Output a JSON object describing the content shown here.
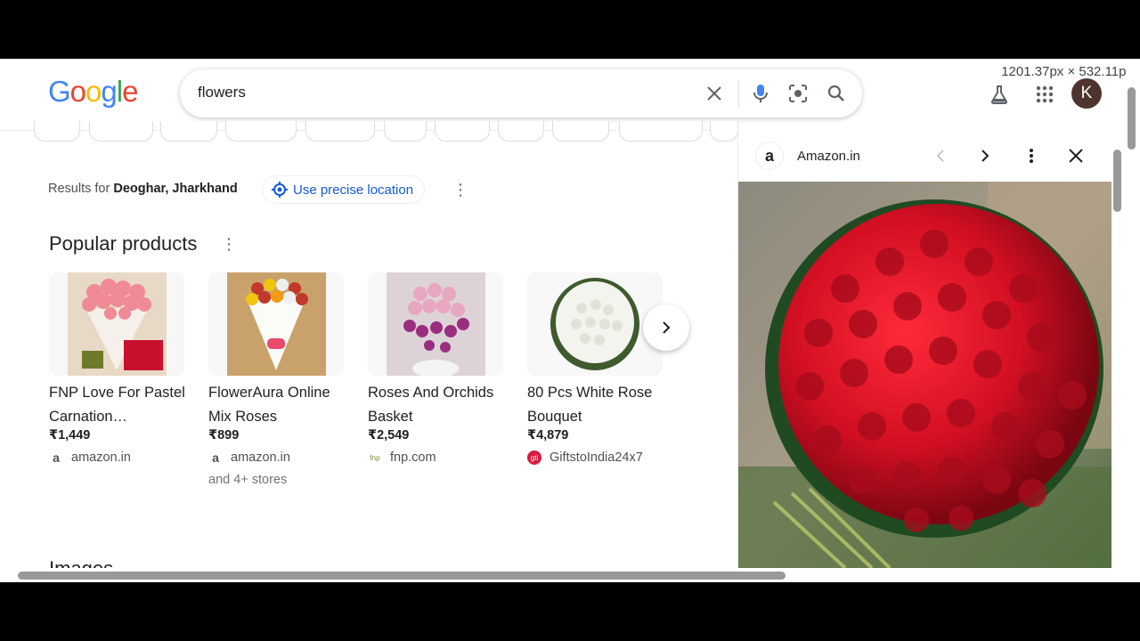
{
  "header": {
    "logo_text": "Google",
    "search_query": "flowers",
    "dimension_readout": "1201.37px × 532.11px",
    "avatar_initial": "K",
    "icons": [
      "clear-icon",
      "mic-icon",
      "lens-icon",
      "search-icon",
      "labs-icon",
      "apps-icon"
    ]
  },
  "location": {
    "prefix": "Results for",
    "place": "Deoghar, Jharkhand",
    "precise_button": "Use precise location"
  },
  "popular_products": {
    "title": "Popular products",
    "items": [
      {
        "name": "FNP Love For Pastel Carnation…",
        "price": "₹1,449",
        "store": "amazon.in",
        "extra": ""
      },
      {
        "name": "FlowerAura Online Mix Roses",
        "price": "₹899",
        "store": "amazon.in",
        "extra": "and 4+ stores"
      },
      {
        "name": "Roses And Orchids Basket",
        "price": "₹2,549",
        "store": "fnp.com",
        "extra": ""
      },
      {
        "name": "80 Pcs White Rose Bouquet",
        "price": "₹4,879",
        "store": "GiftstoIndia24x7",
        "extra": ""
      }
    ]
  },
  "images_section": {
    "title": "Images"
  },
  "panel": {
    "source": "Amazon.in",
    "source_logo": "a"
  },
  "colors": {
    "accent_blue": "#1558d6",
    "google_blue": "#4285F4",
    "google_red": "#EA4335",
    "google_yellow": "#FBBC05",
    "google_green": "#34A853"
  }
}
